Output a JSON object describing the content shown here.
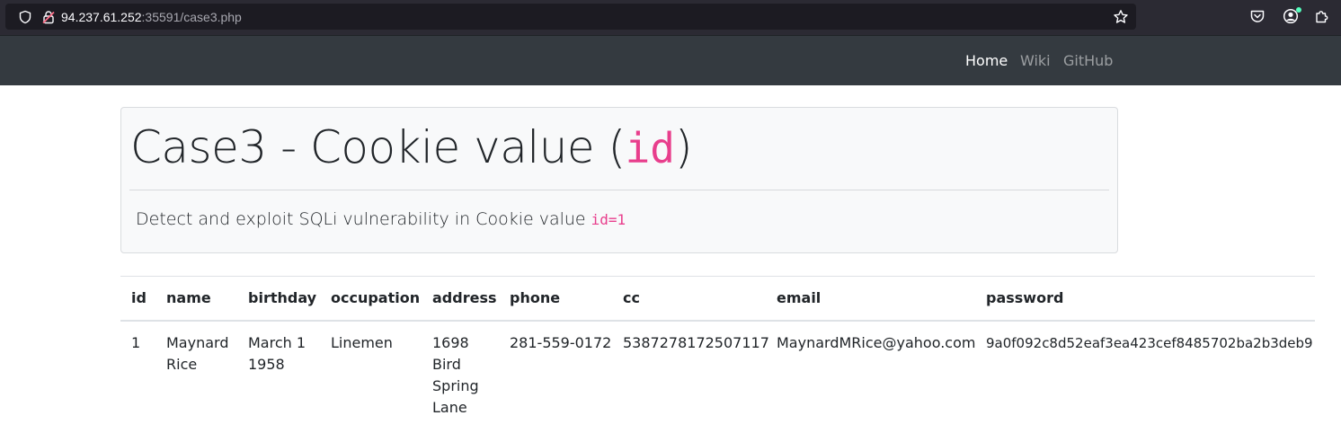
{
  "browser": {
    "url_host": "94.237.61.252",
    "url_rest": ":35591/case3.php",
    "icons": [
      "shield-icon",
      "lock-warning-icon",
      "bookmark-star-icon",
      "pocket-icon",
      "account-icon",
      "extensions-icon"
    ]
  },
  "navbar": {
    "links": [
      {
        "label": "Home",
        "active": true
      },
      {
        "label": "Wiki",
        "active": false
      },
      {
        "label": "GitHub",
        "active": false
      }
    ]
  },
  "jumbotron": {
    "title_prefix": "Case3 - Cookie value (",
    "title_code": "id",
    "title_suffix": ")",
    "lead_text": "Detect and exploit SQLi vulnerability in Cookie value ",
    "lead_code": "id=1"
  },
  "table": {
    "columns": [
      "id",
      "name",
      "birthday",
      "occupation",
      "address",
      "phone",
      "cc",
      "email",
      "password"
    ],
    "rows": [
      {
        "id": "1",
        "name": "Maynard Rice",
        "birthday": "March 1 1958",
        "occupation": "Linemen",
        "address": "1698 Bird Spring Lane",
        "phone": "281-559-0172",
        "cc": "5387278172507117",
        "email": "MaynardMRice@yahoo.com",
        "password": "9a0f092c8d52eaf3ea423cef8485702ba2b3deb9"
      }
    ]
  },
  "colors": {
    "navbar_bg": "#343a40",
    "code_pink": "#e83e8c",
    "jumbotron_bg": "#f8f9fa",
    "browser_bg": "#2b2a33"
  }
}
